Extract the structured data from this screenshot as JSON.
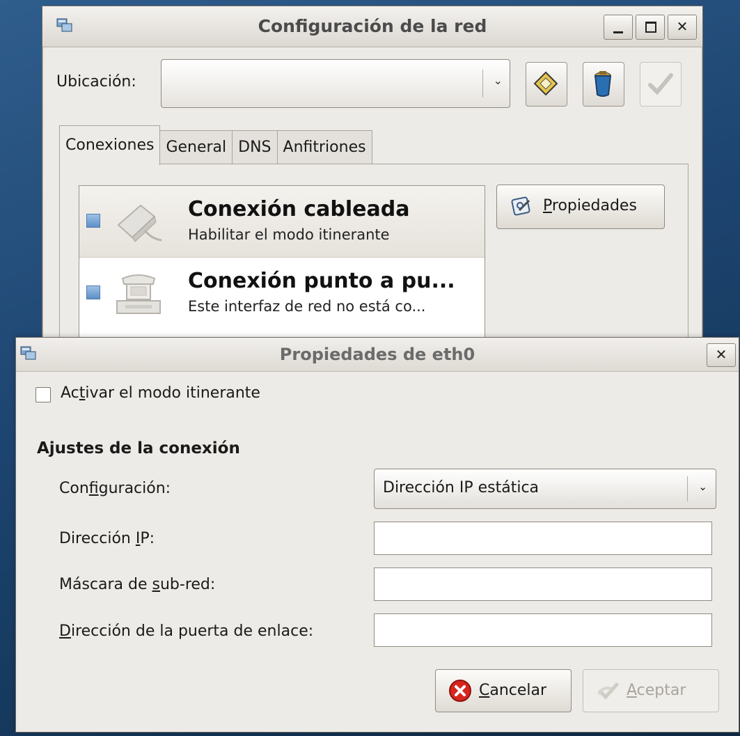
{
  "main_window": {
    "title": "Configuración de la red",
    "location_label": "Ubicación:",
    "location_value": "",
    "tabs": [
      {
        "label": "Conexiones",
        "active": true
      },
      {
        "label": "General",
        "active": false
      },
      {
        "label": "DNS",
        "active": false
      },
      {
        "label": "Anfitriones",
        "active": false
      }
    ],
    "connections": [
      {
        "name": "Conexión cableada",
        "description": "Habilitar el modo itinerante",
        "selected": true,
        "icon": "network-wired-icon"
      },
      {
        "name": "Conexión punto a pu...",
        "description": "Este interfaz de red no está co...",
        "selected": false,
        "icon": "telephone-modem-icon"
      }
    ],
    "properties_button": {
      "mnemonic": "P",
      "rest": "ropiedades"
    }
  },
  "dialog": {
    "title": "Propiedades de eth0",
    "roaming": {
      "before": "Ac",
      "mnemonic": "t",
      "after": "ivar el modo itinerante",
      "checked": false
    },
    "section_title": "Ajustes de la conexión",
    "config": {
      "label_before": "Con",
      "label_mnemonic": "f",
      "label_after": "iguración:",
      "value": "Dirección IP estática"
    },
    "ip": {
      "label_before": "Dirección ",
      "label_mnemonic": "I",
      "label_after": "P:",
      "value": ""
    },
    "netmask": {
      "label_before": "Máscara de ",
      "label_mnemonic": "s",
      "label_after": "ub-red:",
      "value": ""
    },
    "gateway": {
      "label_before": "",
      "label_mnemonic": "D",
      "label_after": "irección de la puerta de enlace:",
      "value": ""
    },
    "cancel": {
      "mnemonic": "C",
      "rest": "ancelar"
    },
    "accept": {
      "mnemonic": "A",
      "rest": "ceptar",
      "enabled": false
    }
  },
  "colors": {
    "desktop": "#1d4470",
    "window_bg": "#edebe7",
    "checkbox_blue": "#5d8fc7",
    "cancel_red": "#d7261e"
  }
}
